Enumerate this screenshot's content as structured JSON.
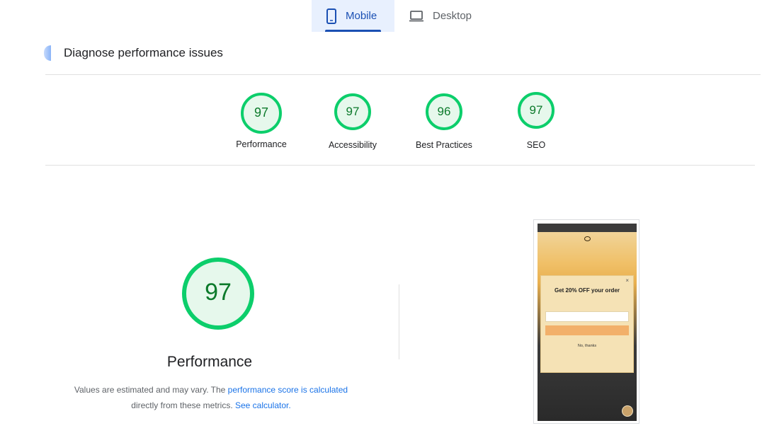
{
  "tabs": [
    {
      "label": "Mobile",
      "icon": "smartphone-icon",
      "active": true
    },
    {
      "label": "Desktop",
      "icon": "laptop-icon",
      "active": false
    }
  ],
  "header": {
    "title": "Diagnose performance issues"
  },
  "categories": [
    {
      "score": "97",
      "label": "Performance",
      "value": 97
    },
    {
      "score": "97",
      "label": "Accessibility",
      "value": 97
    },
    {
      "score": "96",
      "label": "Best Practices",
      "value": 96
    },
    {
      "score": "97",
      "label": "SEO",
      "value": 97
    }
  ],
  "performance": {
    "score": "97",
    "value": 97,
    "title": "Performance",
    "note_prefix": "Values are estimated and may vary. The ",
    "note_link1": "performance score is calculated",
    "note_mid": "directly from these metrics. ",
    "note_link2": "See calculator."
  },
  "screenshot": {
    "popup_title": "Get 20% OFF your order",
    "popup_no_thanks": "No, thanks"
  },
  "colors": {
    "pass_ring": "#0cce6b",
    "pass_fill": "#e6f8ec",
    "pass_text": "#0c7a2b",
    "active_tab_bg": "#e8f0fe",
    "active_tab_text": "#1a4fb3",
    "link": "#1a73e8"
  }
}
